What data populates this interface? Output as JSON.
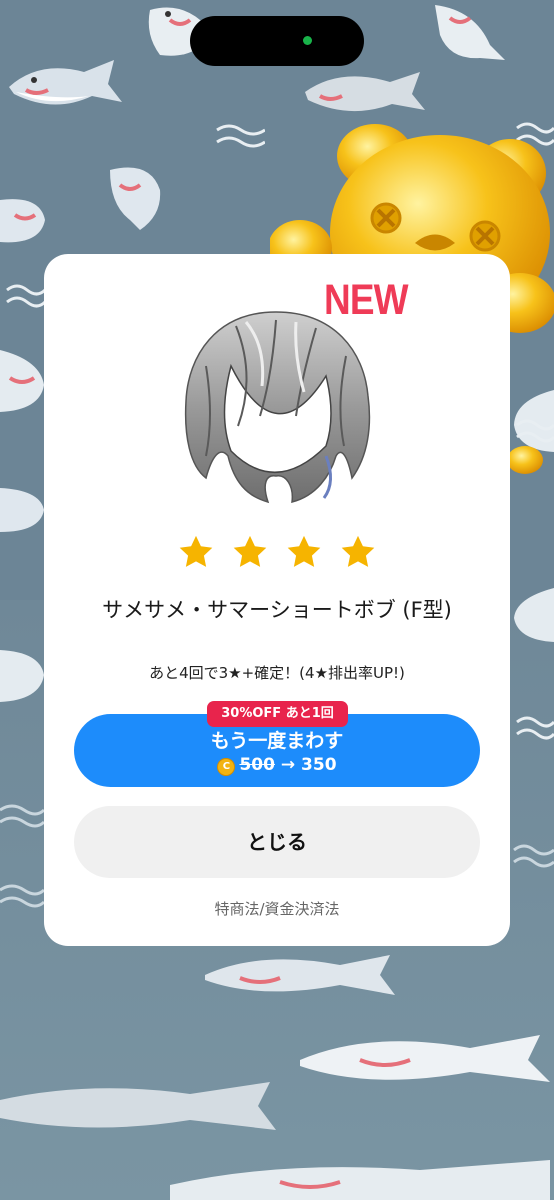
{
  "dialog": {
    "badge": "NEW",
    "rarity_stars": 4,
    "item_name": "サメサメ・サマーショートボブ (F型)",
    "pity_text": "あと4回で3★+確定！(4★排出率UP!)"
  },
  "retry": {
    "discount_badge": "30%OFF あと1回",
    "label": "もう一度まわす",
    "coin_symbol": "C",
    "old_price": "500",
    "arrow": "→",
    "new_price": "350"
  },
  "close_label": "とじる",
  "legal_link": "特商法/資金決済法",
  "colors": {
    "background": "#6c8596",
    "primary_button": "#1d8cfb",
    "discount_badge": "#e8244c",
    "new_badge": "#ef3b57",
    "star": "#f6b400"
  }
}
